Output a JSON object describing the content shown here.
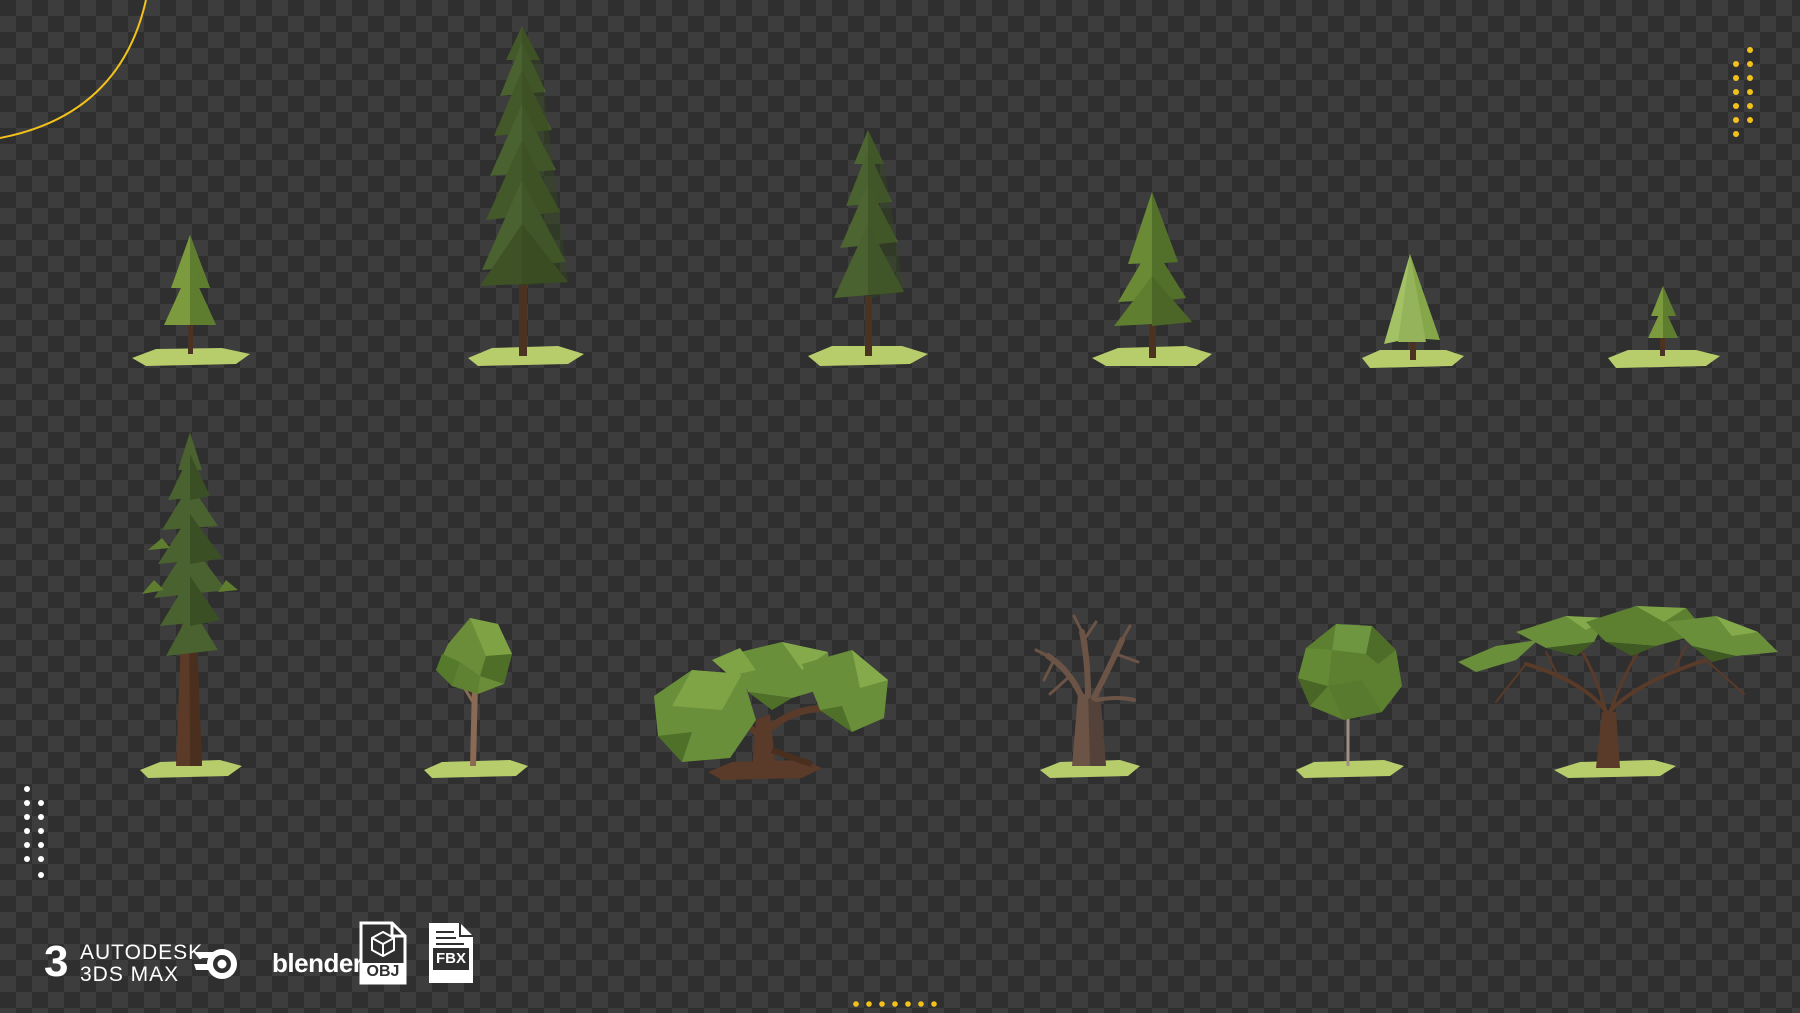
{
  "canvas": {
    "background": "transparency-checkerboard",
    "colors": {
      "accent_yellow": "#f2c21b",
      "white": "#ffffff",
      "dark_green": "#3f5526",
      "mid_green": "#5c7a33",
      "light_green": "#8aa64b",
      "grass": "#b7cc6a",
      "trunk": "#5a3a28"
    }
  },
  "trees": [
    {
      "kind": "small-pine"
    },
    {
      "kind": "tall-pine"
    },
    {
      "kind": "medium-pine"
    },
    {
      "kind": "cone-pine"
    },
    {
      "kind": "light-cypress"
    },
    {
      "kind": "tiny-pine"
    },
    {
      "kind": "redwood"
    },
    {
      "kind": "young-deciduous"
    },
    {
      "kind": "bush-tree"
    },
    {
      "kind": "bare-tree"
    },
    {
      "kind": "round-tree"
    },
    {
      "kind": "acacia"
    }
  ],
  "software_badges": {
    "max_number": "3",
    "max_line1": "AUTODESK",
    "max_line2": "3DS MAX",
    "blender": "blender",
    "obj": "OBJ",
    "fbx": "FBX"
  }
}
